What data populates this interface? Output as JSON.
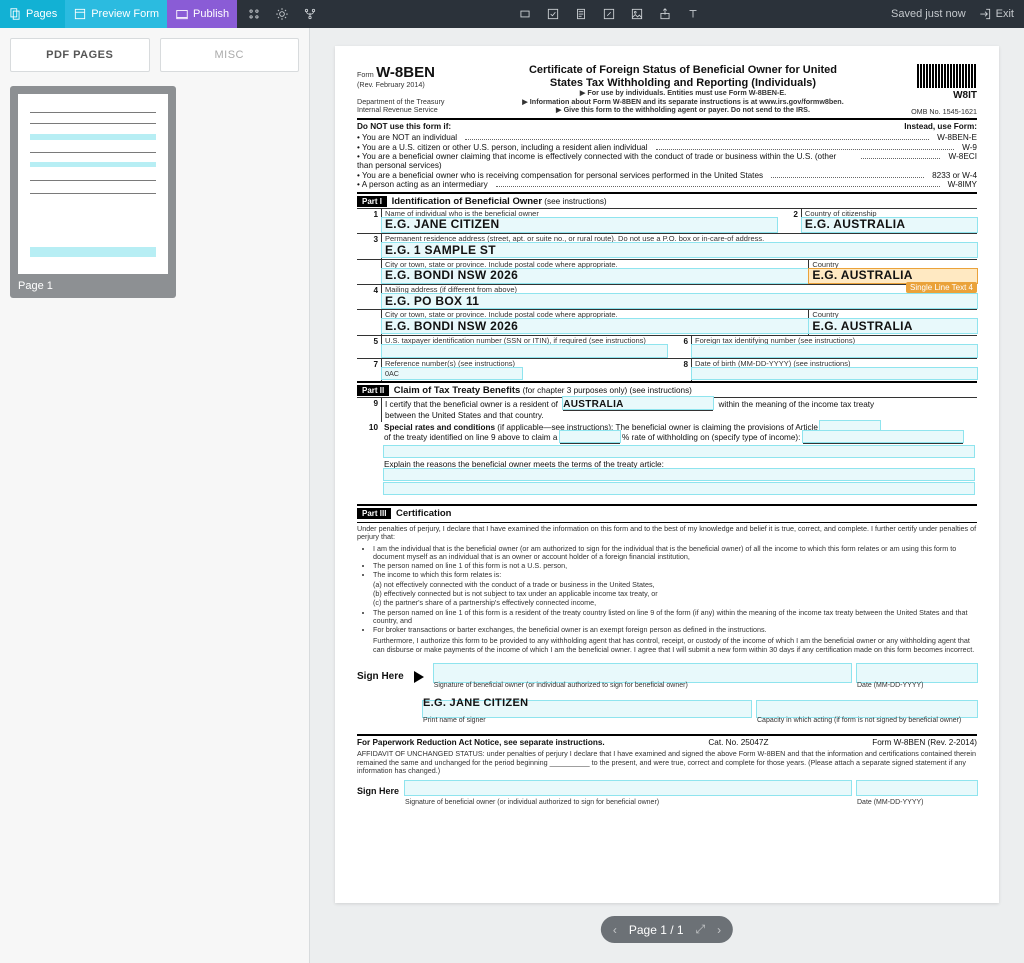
{
  "topbar": {
    "pages": "Pages",
    "preview": "Preview Form",
    "publish": "Publish",
    "saved": "Saved just now",
    "exit": "Exit"
  },
  "sidebar": {
    "tab_pdf": "PDF PAGES",
    "tab_misc": "MISC",
    "thumb_label": "Page 1"
  },
  "form": {
    "form_word": "Form",
    "code": "W-8BEN",
    "rev": "(Rev. February 2014)",
    "dept": "Department of the Treasury",
    "irs": "Internal Revenue Service",
    "title1": "Certificate of Foreign Status of Beneficial Owner for United",
    "title2": "States Tax Withholding and Reporting (Individuals)",
    "sub1": "▶ For use by individuals. Entities must use Form W-8BEN-E.",
    "sub2": "▶ Information about Form W-8BEN and its separate instructions is at www.irs.gov/formw8ben.",
    "sub3": "▶ Give this form to the withholding agent or payer. Do not send to the IRS.",
    "w8it": "W8IT",
    "omb": "OMB No. 1545-1621",
    "donot": "Do NOT use this form if:",
    "instead": "Instead, use Form:",
    "use_items": [
      {
        "l": "• You are NOT an individual",
        "r": "W-8BEN-E"
      },
      {
        "l": "• You are a U.S. citizen or other U.S. person, including a resident alien individual",
        "r": "W-9"
      },
      {
        "l": "• You are a beneficial owner claiming that income is effectively connected with the conduct of trade or business within the U.S. (other than personal services)",
        "r": "W-8ECI"
      },
      {
        "l": "• You are a beneficial owner who is receiving compensation for personal services performed in the United States",
        "r": "8233 or W-4"
      },
      {
        "l": "• A person acting as an intermediary",
        "r": "W-8IMY"
      }
    ],
    "part1": "Part I",
    "part1_t1": "Identification of Beneficial Owner",
    "part1_t2": "(see instructions)",
    "f1_lbl": "Name of individual who is the beneficial owner",
    "f1_val": "E.G. JANE CITIZEN",
    "f2_lbl": "Country of citizenship",
    "f2_val": "E.G. AUSTRALIA",
    "f3_lbl": "Permanent residence address (street, apt. or suite no., or rural route). Do not use a P.O. box or in-care-of address.",
    "f3_val": "E.G. 1 SAMPLE ST",
    "f3b_lbl": "City or town, state or province. Include postal code where appropriate.",
    "f3b_val": "E.G. BONDI NSW 2026",
    "f3c_lbl": "Country",
    "f3c_val": "E.G. AUSTRALIA",
    "orange_tag": "Single Line Text 4",
    "f4_lbl": "Mailing address (if different from above)",
    "f4_val": "E.G. PO BOX 11",
    "f4b_lbl": "City or town, state or province. Include postal code where appropriate.",
    "f4b_val": "E.G. BONDI NSW 2026",
    "f4c_lbl": "Country",
    "f4c_val": "E.G. AUSTRALIA",
    "f5_lbl": "U.S. taxpayer identification number (SSN or ITIN), if required (see instructions)",
    "f6_lbl": "Foreign tax identifying number (see instructions)",
    "f7_lbl": "Reference number(s) (see instructions)",
    "f7_val": "0AC",
    "f8_lbl": "Date of birth (MM-DD-YYYY) (see instructions)",
    "part2": "Part II",
    "part2_t1": "Claim of Tax Treaty Benefits",
    "part2_t2": "(for chapter 3 purposes only) (see instructions)",
    "l9a": "I certify that the beneficial owner is a resident of",
    "l9_country": "AUSTRALIA",
    "l9b": "within the meaning of the income tax treaty",
    "l9c": "between the United States and that country.",
    "l10a": "Special rates and conditions",
    "l10b": "(if applicable—see instructions): The beneficial owner is claiming the provisions of Article",
    "l10c": "of the treaty identified on line 9 above to claim a",
    "l10d": "% rate of withholding on (specify type of income):",
    "l10e": "Explain the reasons the beneficial owner meets the terms of the treaty article:",
    "part3": "Part III",
    "part3_t": "Certification",
    "cert_intro": "Under penalties of perjury, I declare that I have examined the information on this form and to the best of my knowledge and belief it is true, correct, and complete. I further certify under penalties of perjury that:",
    "cert_items": [
      "I am the individual that is the beneficial owner (or am authorized to sign for the individual that is the beneficial owner) of all the income to which this form relates or am using this form to document myself as an individual that is an owner or account holder of a foreign financial institution,",
      "The person named on line 1 of this form is not a U.S. person,",
      "The income to which this form relates is:",
      "(a) not effectively connected with the conduct of a trade or business in the United States,",
      "(b) effectively connected but is not subject to tax under an applicable income tax treaty, or",
      "(c) the partner's share of a partnership's effectively connected income,",
      "The person named on line 1 of this form is a resident of the treaty country listed on line 9 of the form (if any) within the meaning of the income tax treaty between the United States and that country, and",
      "For broker transactions or barter exchanges, the beneficial owner is an exempt foreign person as defined in the instructions."
    ],
    "cert_tail": "Furthermore, I authorize this form to be provided to any withholding agent that has control, receipt, or custody of the income of which I am the beneficial owner or any withholding agent that can disburse or make payments of the income of which I am the beneficial owner. I agree that I will submit a new form within 30 days if any certification made on this form becomes incorrect.",
    "sign_here": "Sign Here",
    "sig_caption": "Signature of beneficial owner (or individual authorized to sign for beneficial owner)",
    "date_caption": "Date (MM-DD-YYYY)",
    "print_name": "E.G. JANE CITIZEN",
    "print_caption": "Print name of signer",
    "capacity_caption": "Capacity in which acting (if form is not signed by beneficial owner)",
    "foot_left": "For Paperwork Reduction Act Notice, see separate instructions.",
    "foot_mid": "Cat. No. 25047Z",
    "foot_right": "Form W-8BEN (Rev. 2-2014)",
    "affidavit": "AFFIDAVIT OF UNCHANGED STATUS: under penalties of perjury I declare that I have examined and signed the above Form W-8BEN and that the information and certifications contained therein remained the same and unchanged for the period beginning __________ to the present, and were true, correct and complete for those years. (Please attach a separate signed statement if any information has changed.)",
    "sign_here2": "Sign Here",
    "sig2_caption": "Signature of beneficial owner (or individual authorized to sign for beneficial owner)",
    "date2_caption": "Date (MM-DD-YYYY)"
  },
  "pager": {
    "text": "Page 1 / 1"
  }
}
